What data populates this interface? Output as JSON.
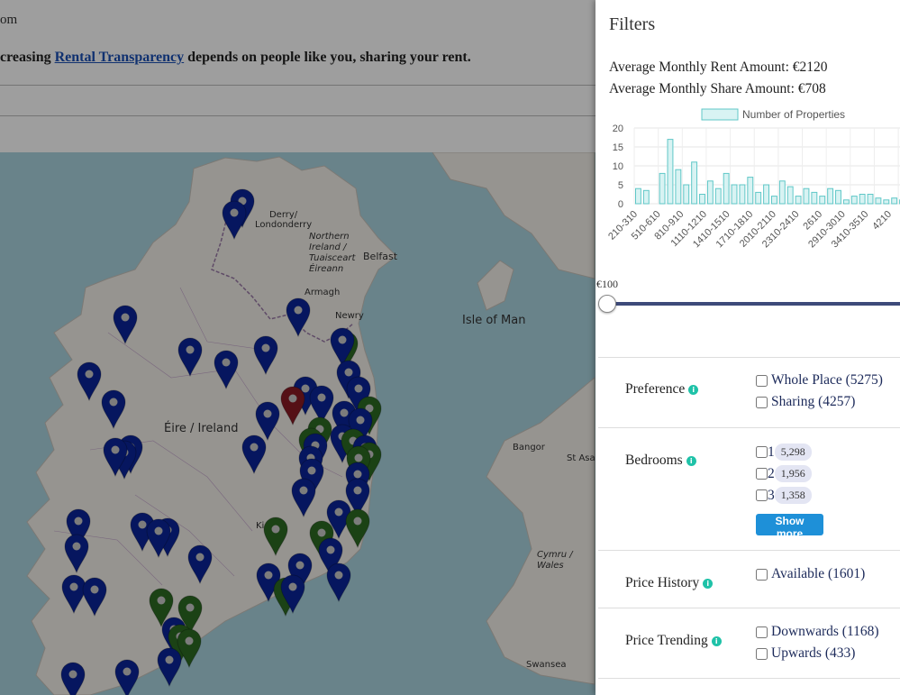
{
  "page": {
    "top_text": "om",
    "tagline_before": "creasing ",
    "tagline_link": "Rental Transparency",
    "tagline_after": " depends on people like you, sharing your rent."
  },
  "map": {
    "labels": {
      "derry": "Derry/\nLondonderry",
      "ni": "Northern\nIreland /\nTuaisceart\nÉireann",
      "belfast": "Belfast",
      "armagh": "Armagh",
      "newry": "Newry",
      "isle_of_man": "Isle of Man",
      "eire": "Éire / Ireland",
      "bangor": "Bangor",
      "st_asaph": "St Asap",
      "cymru": "Cymru /\nWales",
      "swansea": "Swansea",
      "kilkenny": "Ki"
    },
    "colors": {
      "blue": "#0b259a",
      "green": "#2c6b23",
      "red": "#8a1a25"
    }
  },
  "filters": {
    "title": "Filters",
    "avg_rent": "Average Monthly Rent Amount: €2120",
    "avg_share": "Average Monthly Share Amount: €708",
    "slider_label": "€100",
    "preference": {
      "label": "Preference",
      "options": [
        {
          "label": "Whole Place (5275)"
        },
        {
          "label": "Sharing (4257)"
        }
      ]
    },
    "bedrooms": {
      "label": "Bedrooms",
      "options": [
        {
          "num": "1",
          "count": "5,298"
        },
        {
          "num": "2",
          "count": "1,956"
        },
        {
          "num": "3",
          "count": "1,358"
        }
      ],
      "show_more": "Show more"
    },
    "price_history": {
      "label": "Price History",
      "options": [
        {
          "label": "Available (1601)"
        }
      ]
    },
    "price_trending": {
      "label": "Price Trending",
      "options": [
        {
          "label": "Downwards (1168)"
        },
        {
          "label": "Upwards (433)"
        }
      ]
    }
  },
  "chart_data": {
    "type": "bar",
    "legend": "Number of Properties",
    "yticks": [
      0,
      5,
      10,
      15,
      20
    ],
    "ylim": [
      0,
      20
    ],
    "xtick_labels": [
      "210-310",
      "510-610",
      "810-910",
      "1110-1210",
      "1410-1510",
      "1710-1810",
      "2010-2110",
      "2310-2410",
      "2610",
      "2910-3010",
      "3410-3510",
      "4210"
    ],
    "values": [
      4,
      3.5,
      0,
      8,
      17,
      9,
      5,
      11,
      2.5,
      6,
      4,
      8,
      5,
      5,
      7,
      3,
      5,
      2,
      6,
      4.5,
      2,
      4,
      3,
      2,
      4,
      3.5,
      1,
      2,
      2.5,
      2.5,
      1.5,
      1,
      1.5,
      1
    ],
    "colors": {
      "fill": "#d8f3f3",
      "stroke": "#5fc7c7"
    }
  }
}
